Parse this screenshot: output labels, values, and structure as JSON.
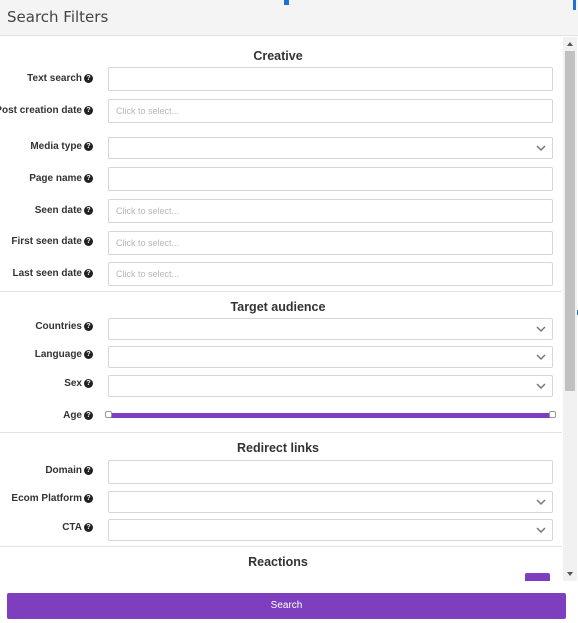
{
  "header": {
    "title": "Search Filters"
  },
  "sections": {
    "creative": {
      "title": "Creative",
      "text_search": {
        "label": "Text search",
        "value": ""
      },
      "post_creation_date": {
        "label": "Post creation date",
        "placeholder": "Click to select..."
      },
      "media_type": {
        "label": "Media type",
        "value": ""
      },
      "page_name": {
        "label": "Page name",
        "value": ""
      },
      "seen_date": {
        "label": "Seen date",
        "placeholder": "Click to select..."
      },
      "first_seen_date": {
        "label": "First seen date",
        "placeholder": "Click to select..."
      },
      "last_seen_date": {
        "label": "Last seen date",
        "placeholder": "Click to select..."
      }
    },
    "target_audience": {
      "title": "Target audience",
      "countries": {
        "label": "Countries",
        "value": ""
      },
      "language": {
        "label": "Language",
        "value": ""
      },
      "sex": {
        "label": "Sex",
        "value": ""
      },
      "age": {
        "label": "Age",
        "range_fraction": [
          0,
          1
        ]
      }
    },
    "redirect_links": {
      "title": "Redirect links",
      "domain": {
        "label": "Domain",
        "value": ""
      },
      "ecom_platform": {
        "label": "Ecom Platform",
        "value": ""
      },
      "cta": {
        "label": "CTA",
        "value": ""
      }
    },
    "reactions": {
      "title": "Reactions"
    }
  },
  "help_icon": "question-circle-icon",
  "footer": {
    "search_label": "Search"
  },
  "colors": {
    "accent": "#7e3fbf",
    "handle": "#1f6fd6"
  }
}
